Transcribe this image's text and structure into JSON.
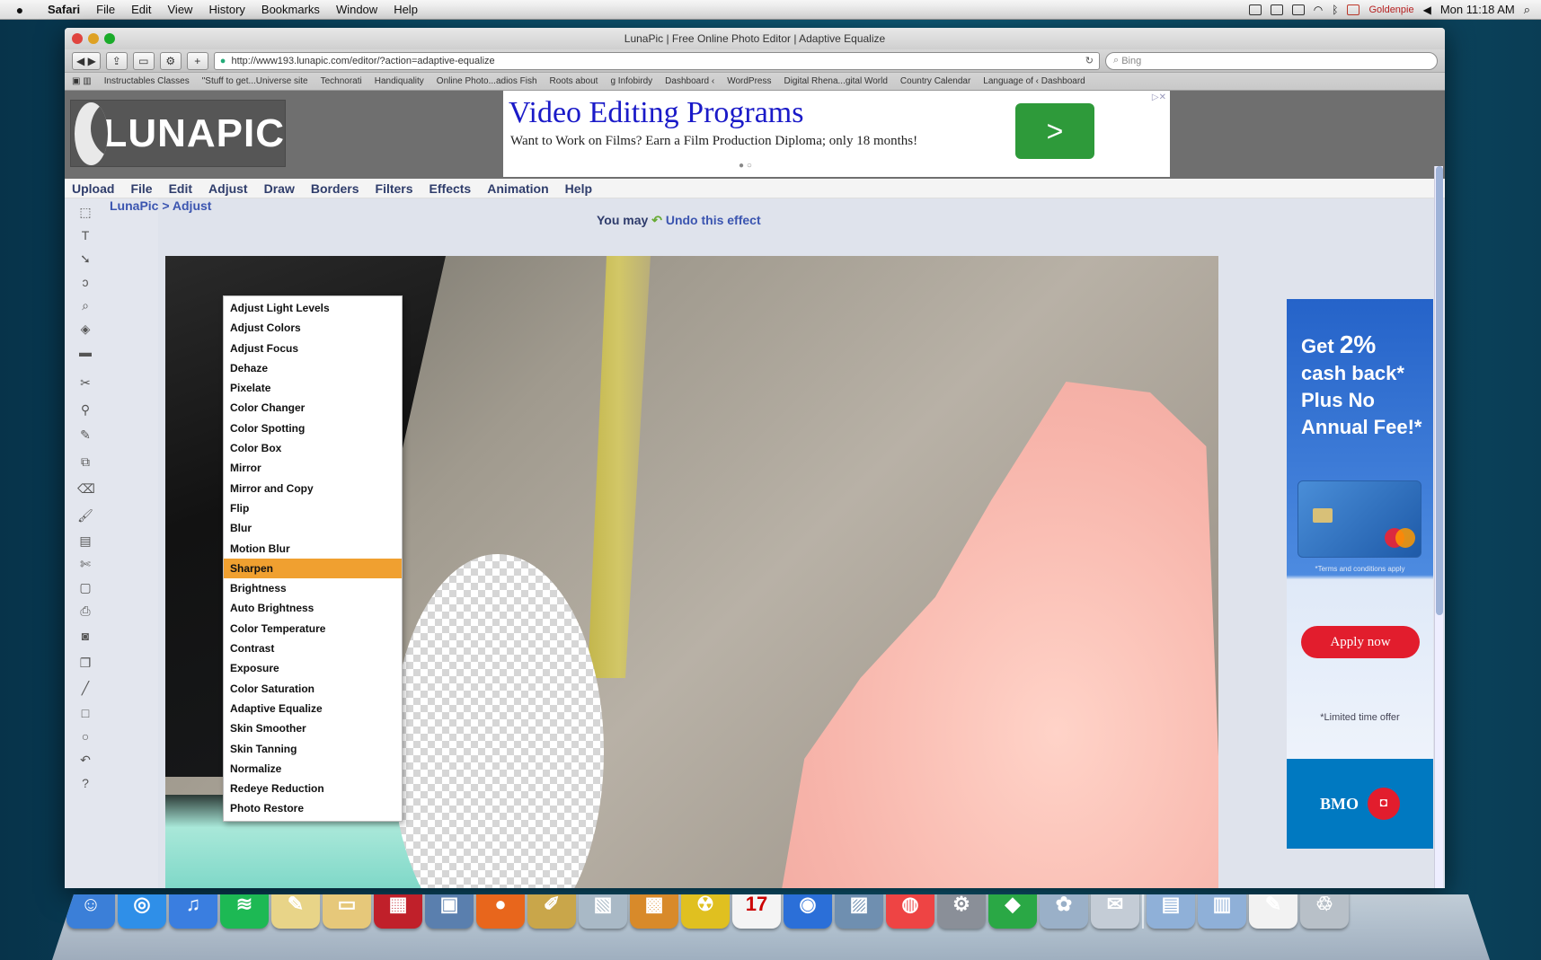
{
  "menubar": {
    "apple": "",
    "items": [
      "Safari",
      "File",
      "Edit",
      "View",
      "History",
      "Bookmarks",
      "Window",
      "Help"
    ],
    "clock": "Mon 11:18 AM",
    "user": "Goldenpie"
  },
  "browser": {
    "title": "LunaPic | Free Online Photo Editor | Adaptive Equalize",
    "url": "http://www193.lunapic.com/editor/?action=adaptive-equalize",
    "search_placeholder": "Bing",
    "bookmarks": [
      "Instructables Classes",
      "\"Stuff to get...Universe site",
      "Technorati",
      "Handiquality",
      "Online Photo...adios Fish",
      "Roots about",
      "g Infobirdy",
      "Dashboard ‹",
      "WordPress",
      "Digital Rhena...gital World",
      "Country Calendar",
      "Language of ‹ Dashboard"
    ]
  },
  "lunapic": {
    "logo_text": "LUNAPIC",
    "ad_top": {
      "headline": "Video Editing Programs",
      "subline": "Want to Work on Films? Earn a Film Production Diploma; only 18 months!",
      "cta": ">"
    },
    "nav": [
      "Upload",
      "File",
      "Edit",
      "Adjust",
      "Draw",
      "Borders",
      "Filters",
      "Effects",
      "Animation",
      "Help"
    ],
    "breadcrumb": "LunaPic > Adjust",
    "undo_prefix": "You may",
    "undo_link": "Undo this effect",
    "adjust_menu": [
      "Adjust Light Levels",
      "Adjust Colors",
      "Adjust Focus",
      "Dehaze",
      "Pixelate",
      "Color Changer",
      "Color Spotting",
      "Color Box",
      "Mirror",
      "Mirror and Copy",
      "Flip",
      "Blur",
      "Motion Blur",
      "Sharpen",
      "Brightness",
      "Auto Brightness",
      "Color Temperature",
      "Contrast",
      "Exposure",
      "Color Saturation",
      "Adaptive Equalize",
      "Skin Smoother",
      "Skin Tanning",
      "Normalize",
      "Redeye Reduction",
      "Photo Restore"
    ],
    "highlighted_item": "Sharpen",
    "ad_right": {
      "line1": "Get",
      "big": "2%",
      "line2": "cash back*",
      "line3": "Plus No",
      "line4": "Annual Fee!*",
      "fine": "*Terms and conditions apply",
      "apply": "Apply now",
      "limited": "*Limited time offer",
      "brand": "BMO"
    }
  },
  "dock": {
    "apps": [
      "Finder",
      "Safari",
      "iTunes",
      "Spotify",
      "Preview",
      "Notes",
      "Photo Booth",
      "iPhoto",
      "Firefox",
      "Script Editor",
      "Photos",
      "Keynote",
      "Radiation",
      "Calendar",
      "QuickTime",
      "Preview 2",
      "Chrome",
      "System Preferences",
      "Evernote",
      "Image Capture",
      "Mail",
      "Applications",
      "Documents",
      "TextEdit",
      "Trash"
    ],
    "calendar_day": "17"
  },
  "colors": {
    "accent_highlight": "#f0a030",
    "link": "#3b55b0",
    "apply_red": "#e21d2d",
    "bmo_blue": "#0079c1"
  }
}
